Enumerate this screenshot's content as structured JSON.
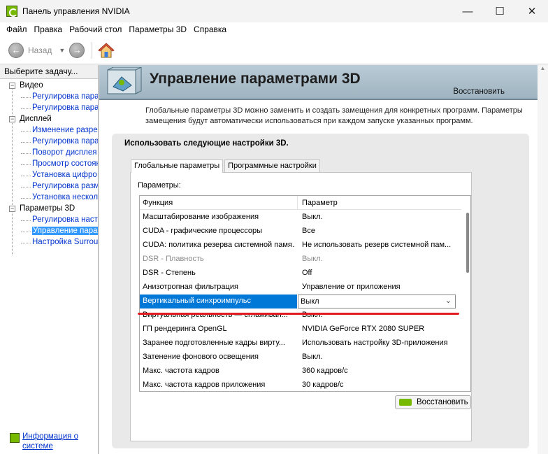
{
  "window": {
    "title": "Панель управления NVIDIA",
    "controls": {
      "minimize": "—",
      "maximize": "☐",
      "close": "✕"
    }
  },
  "menubar": {
    "items": [
      "Файл",
      "Правка",
      "Рабочий стол",
      "Параметры 3D",
      "Справка"
    ]
  },
  "toolbar": {
    "back_label": "Назад",
    "icons": [
      "back-arrow-icon",
      "dropdown-icon",
      "forward-arrow-icon",
      "home-icon"
    ]
  },
  "sidebar": {
    "header": "Выберите задачу...",
    "tree": [
      {
        "label": "Видео",
        "expander": "−",
        "children": [
          "Регулировка пара",
          "Регулировка пара"
        ]
      },
      {
        "label": "Дисплей",
        "expander": "−",
        "children": [
          "Изменение разреш",
          "Регулировка пара",
          "Поворот дисплея",
          "Просмотр состоян",
          "Установка цифро",
          "Регулировка разм",
          "Установка несколь"
        ]
      },
      {
        "label": "Параметры 3D",
        "expander": "−",
        "children": [
          "Регулировка наст",
          "Управление парам",
          "Настройка Surrou"
        ],
        "selected_child": 1
      }
    ],
    "info_link": "Информация о системе"
  },
  "main": {
    "title": "Управление параметрами 3D",
    "restore_link": "Восстановить",
    "description": "Глобальные параметры 3D можно заменить и создать замещения для конкретных программ. Параметры замещения будут автоматически использоваться при каждом запуске указанных программ.",
    "panel_heading": "Использовать следующие настройки 3D.",
    "tabs": [
      "Глобальные параметры",
      "Программные настройки"
    ],
    "active_tab": 0,
    "params_label": "Параметры:",
    "columns": {
      "function": "Функция",
      "parameter": "Параметр"
    },
    "rows": [
      {
        "function": "Масштабирование изображения",
        "parameter": "Выкл."
      },
      {
        "function": "CUDA - графические процессоры",
        "parameter": "Все"
      },
      {
        "function": "CUDA: политика резерва системной памя...",
        "parameter": "Не использовать резерв системной пам..."
      },
      {
        "function": "DSR - Плавность",
        "parameter": "Выкл.",
        "disabled": true
      },
      {
        "function": "DSR - Степень",
        "parameter": "Off"
      },
      {
        "function": "Анизотропная фильтрация",
        "parameter": "Управление от приложения"
      },
      {
        "function": "Вертикальный синхроимпульс",
        "parameter": "Выкл",
        "selected": true
      },
      {
        "function": "Виртуальная реальность — сглаживан...",
        "parameter": "Выкл."
      },
      {
        "function": "ГП рендеринга OpenGL",
        "parameter": "NVIDIA GeForce RTX 2080 SUPER"
      },
      {
        "function": "Заранее подготовленные кадры вирту...",
        "parameter": "Использовать настройку 3D-приложения"
      },
      {
        "function": "Затенение фонового освещения",
        "parameter": "Выкл."
      },
      {
        "function": "Макс. частота кадров",
        "parameter": "360 кадров/с"
      },
      {
        "function": "Макс. частота кадров приложения",
        "parameter": "30 кадров/с"
      }
    ],
    "restore_button": "Восстановить"
  },
  "colors": {
    "accent_blue": "#0078d7",
    "nvidia_green": "#76b900",
    "annotation_red": "#e11b22",
    "link_blue": "#0033cc"
  }
}
